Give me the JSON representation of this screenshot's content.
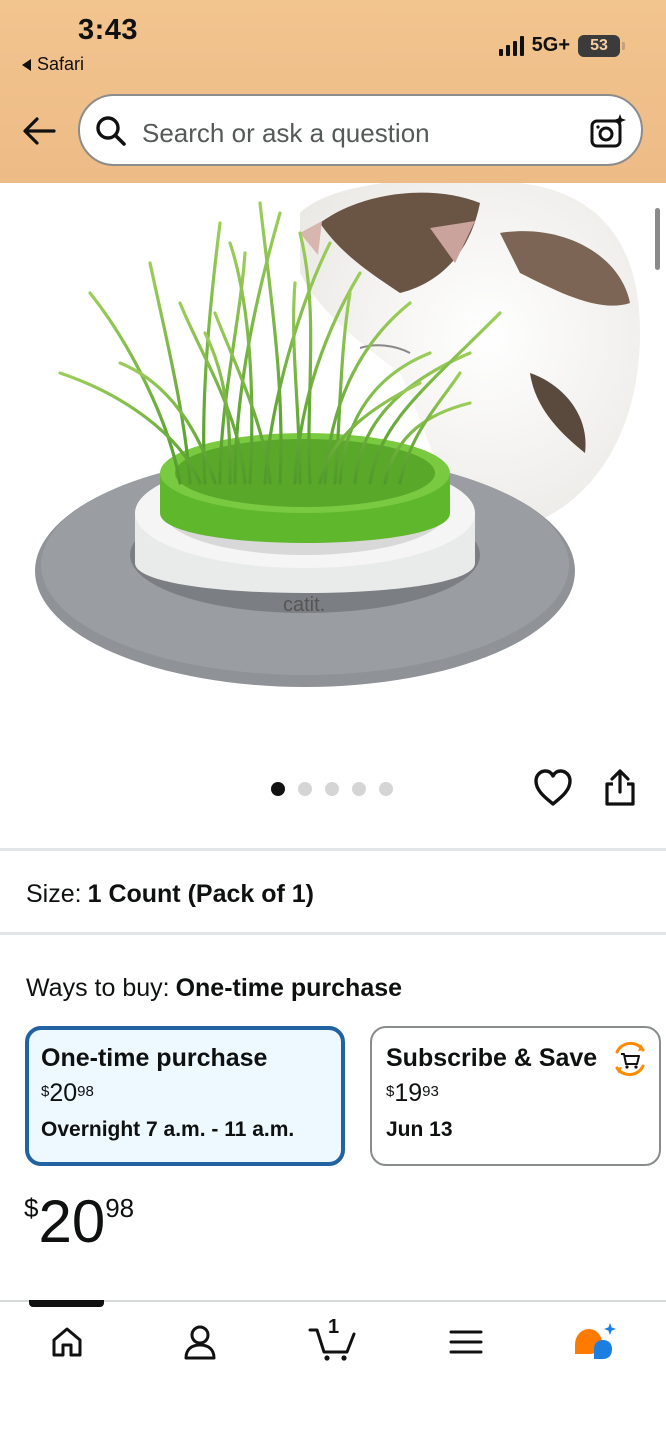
{
  "status_bar": {
    "time": "3:43",
    "back_app": "Safari",
    "network": "5G+",
    "battery": "53"
  },
  "search": {
    "placeholder": "Search or ask a question"
  },
  "gallery": {
    "image_count": 5,
    "active_index": 0,
    "brand_on_product": "catit"
  },
  "size": {
    "label": "Size:",
    "value": "1 Count (Pack of 1)"
  },
  "ways_to_buy": {
    "label": "Ways to buy:",
    "selected": "One-time purchase"
  },
  "options": [
    {
      "title": "One-time purchase",
      "price_symbol": "$",
      "price_whole": "20",
      "price_cents": "98",
      "delivery": "Overnight 7 a.m. - 11 a.m.",
      "selected": true
    },
    {
      "title": "Subscribe & Save",
      "price_symbol": "$",
      "price_whole": "19",
      "price_cents": "93",
      "delivery": "Jun 13",
      "selected": false
    }
  ],
  "price": {
    "symbol": "$",
    "whole": "20",
    "cents": "98"
  },
  "bottom_nav": {
    "cart_count": "1",
    "items": [
      "home-icon",
      "account-icon",
      "cart-icon",
      "menu-icon",
      "rufus-icon"
    ]
  },
  "colors": {
    "header_bg": "#f0c08a",
    "selected_border": "#2162a1",
    "selected_bg": "#edf8ff",
    "accent_orange": "#ff8a00"
  }
}
